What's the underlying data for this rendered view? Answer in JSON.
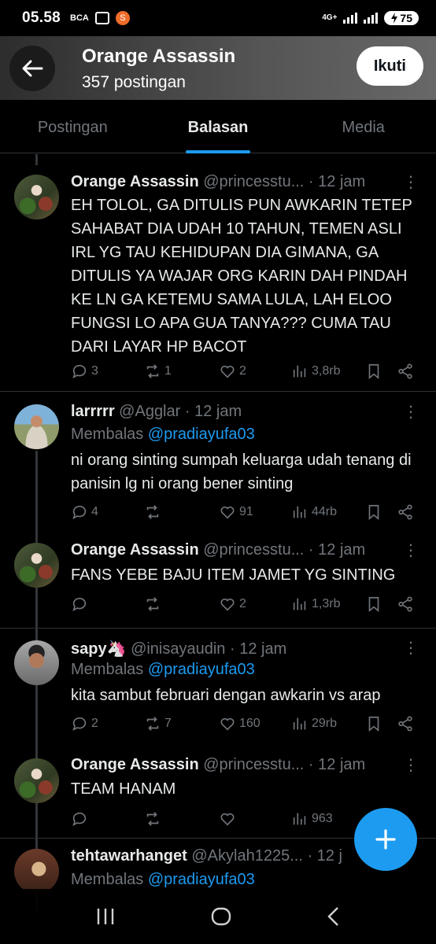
{
  "status": {
    "time": "05.58",
    "icon_bca": "BCA",
    "icon_shopee": "S",
    "net": "4G+",
    "battery": "75"
  },
  "header": {
    "title": "Orange Assassin",
    "subtitle": "357 postingan",
    "follow_label": "Ikuti"
  },
  "tabs": [
    {
      "label": "Postingan",
      "active": false
    },
    {
      "label": "Balasan",
      "active": true
    },
    {
      "label": "Media",
      "active": false
    }
  ],
  "posts": [
    {
      "name": "Orange Assassin",
      "handle": "@princesstu...",
      "time": "· 12 jam",
      "reply_prefix": "",
      "reply_to": "",
      "text": "EH TOLOL, GA DITULIS PUN AWKARIN TETEP SAHABAT DIA UDAH 10 TAHUN, TEMEN ASLI IRL YG TAU KEHIDUPAN DIA GIMANA, GA DITULIS YA WAJAR ORG KARIN DAH PINDAH KE LN GA KETEMU SAMA LULA, LAH ELOO FUNGSI LO APA GUA TANYA??? CUMA TAU DARI LAYAR HP BACOT",
      "replies": "3",
      "reposts": "1",
      "likes": "2",
      "views": "3,8rb"
    },
    {
      "name": "larrrrr",
      "handle": "@Agglar",
      "time": "· 12 jam",
      "reply_prefix": "Membalas ",
      "reply_to": "@pradiayufa03",
      "text": "ni orang sinting sumpah keluarga udah tenang di panisin lg ni orang bener sinting",
      "replies": "4",
      "reposts": "",
      "likes": "91",
      "views": "44rb"
    },
    {
      "name": "Orange Assassin",
      "handle": "@princesstu...",
      "time": "· 12 jam",
      "reply_prefix": "",
      "reply_to": "",
      "text": "FANS YEBE BAJU ITEM JAMET YG SINTING",
      "replies": "",
      "reposts": "",
      "likes": "2",
      "views": "1,3rb"
    },
    {
      "name": "sapy🦄",
      "handle": "@inisayaudin",
      "time": "· 12 jam",
      "reply_prefix": "Membalas ",
      "reply_to": "@pradiayufa03",
      "text": "kita sambut februari dengan awkarin vs arap",
      "replies": "2",
      "reposts": "7",
      "likes": "160",
      "views": "29rb"
    },
    {
      "name": "Orange Assassin",
      "handle": "@princesstu...",
      "time": "· 12 jam",
      "reply_prefix": "",
      "reply_to": "",
      "text": "TEAM HANAM",
      "replies": "",
      "reposts": "",
      "likes": "",
      "views": "963"
    },
    {
      "name": "tehtawarhanget",
      "handle": "@Akylah1225...",
      "time": "· 12 j",
      "reply_prefix": "Membalas ",
      "reply_to": "@pradiayufa03",
      "text": "",
      "replies": "",
      "reposts": "",
      "likes": "",
      "views": ""
    }
  ],
  "icons": {
    "back": "arrow-left-icon",
    "more": "more-dots-icon",
    "reply": "comment-icon",
    "repost": "repost-icon",
    "like": "heart-icon",
    "views": "views-chart-icon",
    "bookmark": "bookmark-icon",
    "share": "share-icon",
    "compose": "plus-icon"
  },
  "colors": {
    "accent": "#1d9bf0",
    "muted": "#71767b",
    "text": "#e7e9ea",
    "divider": "#2f3336"
  }
}
